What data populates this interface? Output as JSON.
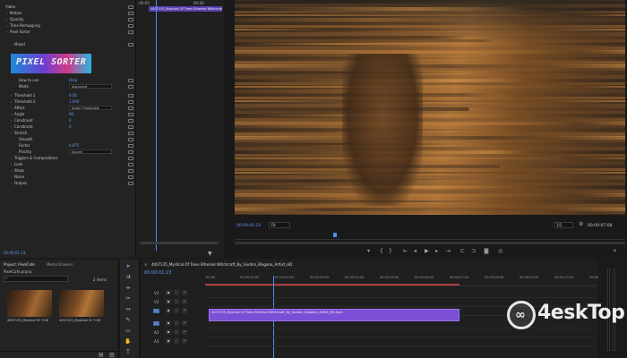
{
  "effect_controls": {
    "rows": [
      {
        "label": "Video",
        "indent": 0
      },
      {
        "label": "Motion",
        "indent": 1
      },
      {
        "label": "Opacity",
        "indent": 1
      },
      {
        "label": "Time Remapping",
        "indent": 1
      },
      {
        "label": "Pixel Sorter",
        "indent": 1
      },
      {
        "label": "Mixed",
        "indent": 2
      },
      {
        "label": "How to use",
        "indent": 3,
        "value": "Help"
      },
      {
        "label": "Mode",
        "indent": 3,
        "dropdown": "Advanced"
      },
      {
        "label": "Threshold 1",
        "indent": 2,
        "value": "0.00"
      },
      {
        "label": "Threshold 2",
        "indent": 2,
        "value": "1.000"
      },
      {
        "label": "Affect",
        "indent": 2,
        "dropdown": "Inside Thresholds"
      },
      {
        "label": "Angle",
        "indent": 2,
        "value": "90"
      },
      {
        "label": "Constraint",
        "indent": 2,
        "value": "0"
      },
      {
        "label": "Constraint",
        "indent": 2,
        "value": "0"
      },
      {
        "label": "Stretch",
        "indent": 2
      },
      {
        "label": "Smooth",
        "indent": 3
      },
      {
        "label": "Factor",
        "indent": 3,
        "value": "0.875"
      },
      {
        "label": "Priority",
        "indent": 3,
        "dropdown": "Source"
      },
      {
        "label": "Triggers & Compositions",
        "indent": 2
      },
      {
        "label": "Look",
        "indent": 2
      },
      {
        "label": "Steps",
        "indent": 2
      },
      {
        "label": "Noise",
        "indent": 2
      },
      {
        "label": "Output",
        "indent": 2
      }
    ],
    "plugin_logo_text": "PIXEL SORTER",
    "timecode": "00:00:01:23"
  },
  "fx_timeline": {
    "time_start": ":00:00",
    "time_end": "00:00:",
    "clip_label": "4007135_Mystical Of Trees Ethereal Witchcraft_By_"
  },
  "program_monitor": {
    "current_time": "00:00:01:23",
    "fit_label": "Fit",
    "quality": "1/2",
    "duration": "00:00:07:08"
  },
  "project_panel": {
    "tabs": [
      "Project: PixelCafe",
      "Media Browser"
    ],
    "file": "PixelCafe.prproj",
    "item_count": "2 items",
    "search_placeholder": "",
    "items": [
      {
        "name": "4007135_Mystical Of",
        "dur": "7:08"
      },
      {
        "name": "4007135_Mystical Of",
        "dur": "7:08"
      }
    ]
  },
  "timeline": {
    "tab_label": "4007135_Mystical Of Trees Ethereal Witchcraft_By_Gordon_Blogano_Artlist_HD",
    "timecode": "00:00:01:23",
    "ruler_labels": [
      ":00:00",
      "00:00:01:00",
      "00:00:02:00",
      "00:00:03:00",
      "00:00:04:00",
      "00:00:05:00",
      "00:00:06:00",
      "00:00:07:00",
      "00:00:08:00",
      "00:00:09:00",
      "00:00:10:00",
      "00:00:11:00"
    ],
    "clip_name": "4007135_Mystical Of Trees Ethereal Witchcraft_By_Gordon_Blogano_Artlist_HD.mp4",
    "tracks_video": [
      "V3",
      "V2",
      "V1"
    ],
    "tracks_audio": [
      "A1",
      "A2",
      "A3"
    ]
  },
  "watermark": {
    "brand": "4eskTop"
  },
  "colors": {
    "accent": "#5c9bf0",
    "clip": "#7b4fd6",
    "playhead": "#4a8ef0"
  }
}
